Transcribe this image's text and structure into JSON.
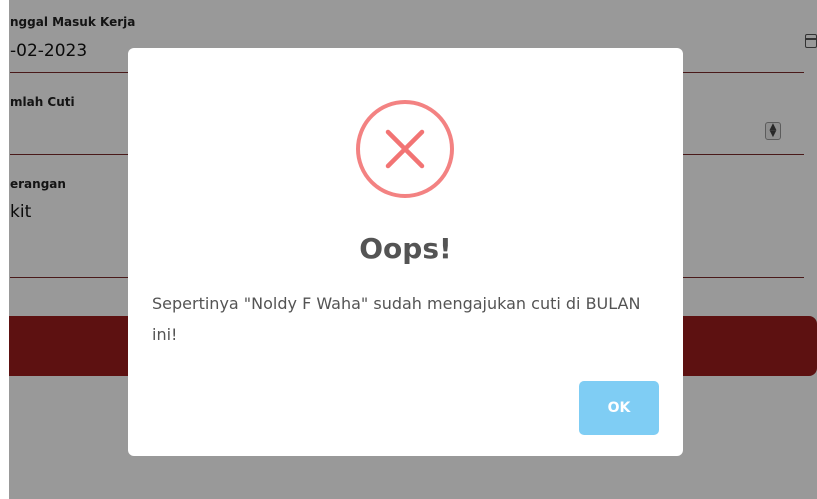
{
  "form": {
    "start_date_label": "nggal Masuk Kerja",
    "start_date_value": "-02-2023",
    "leave_count_label": "mlah Cuti",
    "notes_label": "erangan",
    "notes_value": "kit"
  },
  "dialog": {
    "title": "Oops!",
    "message": "Sepertinya \"Noldy F Waha\" sudah mengajukan cuti di BULAN ini!",
    "ok_label": "OK",
    "icon": "error-x-icon"
  },
  "colors": {
    "error_icon": "#f27474",
    "ok_button": "#7fcdf4",
    "submit_bar": "#9b1d1d",
    "field_underline": "#7a2a2a"
  }
}
